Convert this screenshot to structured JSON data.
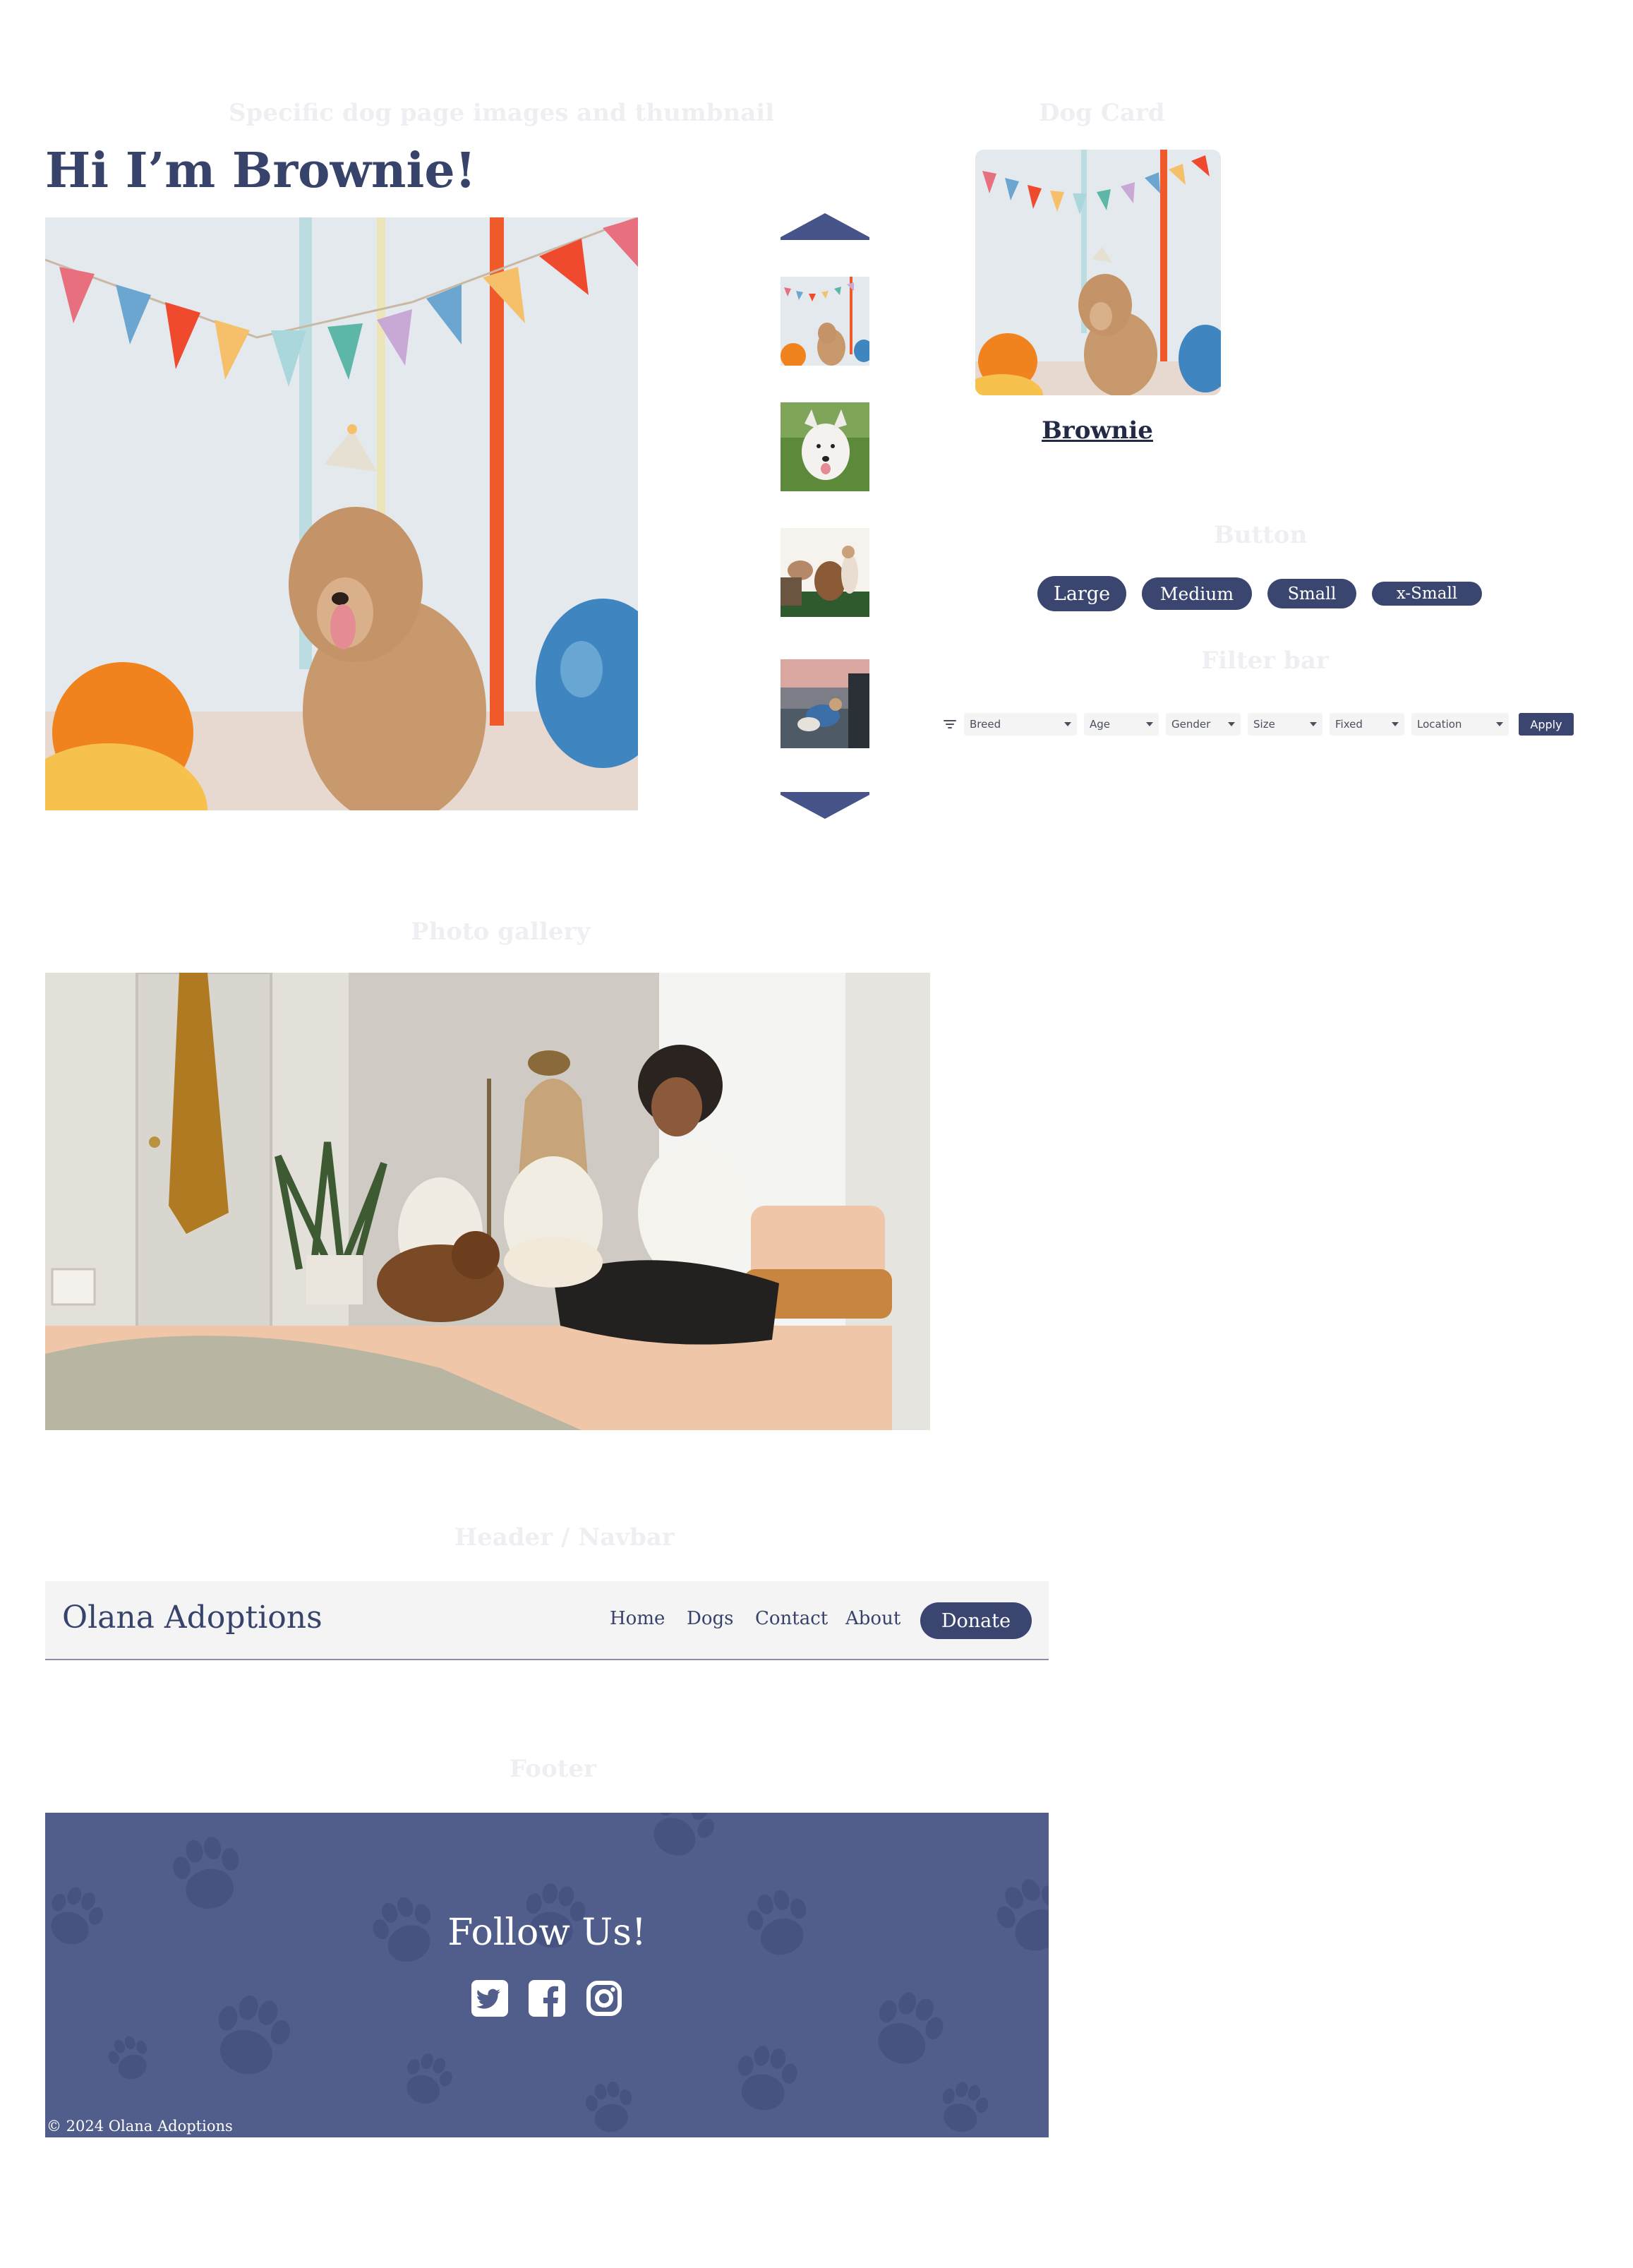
{
  "section_labels": {
    "dog_page": "Specific dog page images and thumbnail",
    "dog_card": "Dog Card",
    "button": "Button",
    "filter_bar": "Filter bar",
    "photo_gallery": "Photo gallery",
    "header": "Header / Navbar",
    "footer": "Footer"
  },
  "hero": {
    "title": "Hi I’m Brownie!"
  },
  "dog_card": {
    "name": "Brownie"
  },
  "buttons": {
    "large": "Large",
    "medium": "Medium",
    "small": "Small",
    "xsmall": "x-Small"
  },
  "filter_bar": {
    "breed": "Breed",
    "age": "Age",
    "gender": "Gender",
    "size": "Size",
    "fixed": "Fixed",
    "location": "Location",
    "apply": "Apply"
  },
  "navbar": {
    "brand": "Olana Adoptions",
    "links": [
      "Home",
      "Dogs",
      "Contact",
      "About"
    ],
    "donate": "Donate"
  },
  "footer": {
    "heading": "Follow Us!",
    "icons": [
      "twitter-icon",
      "facebook-icon",
      "instagram-icon"
    ],
    "copyright": "© 2024 Olana Adoptions"
  },
  "colors": {
    "brand": "#38436b",
    "button": "#3b4670",
    "footer_bg": "#515d8b",
    "navbar_bg": "#f4f4f5"
  }
}
